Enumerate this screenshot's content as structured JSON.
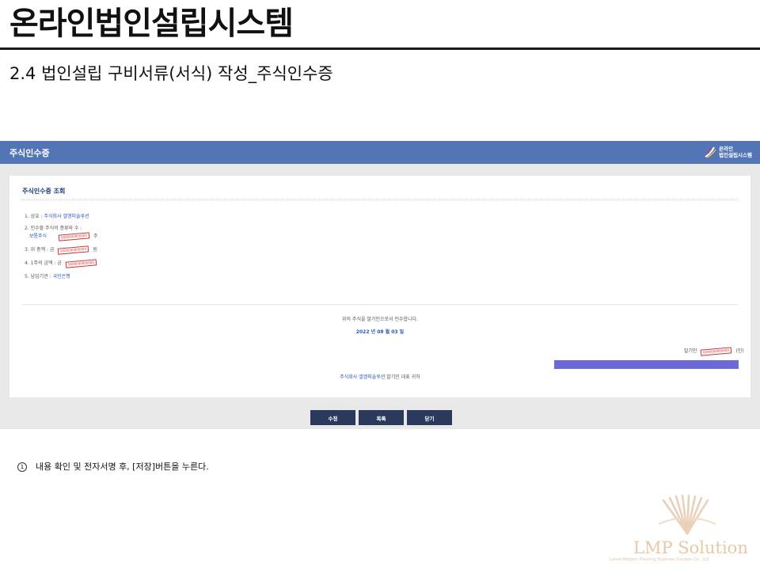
{
  "slide": {
    "title": "온라인법인설립시스템",
    "subtitle": "2.4 법인설립 구비서류(서식) 작성_주식인수증"
  },
  "app": {
    "header_title": "주식인수증",
    "logo_line1": "온라인",
    "logo_line2": "법인설립시스템"
  },
  "panel": {
    "title": "주식인수증 조회",
    "row1_label": "1. 상호 : ",
    "row1_value": "주식회사 엘엠피솔루션",
    "row2_label": "2. 인수할 주식의 종류와 수 :",
    "row2_kind": "보통주식",
    "row2_unit": "주",
    "row3_label": "3. 위 총액 : 금",
    "row3_unit": "원",
    "row4_label": "4. 1주의 금액 : 금",
    "row5_label": "5. 납입기관 : ",
    "row5_value": "국민은행",
    "stamp_text": "0000000000000",
    "statement": "위의 주식을 발기인으로서 인수합니다.",
    "date": "2022 년 08 월 03 일",
    "issuer_label": "발기인",
    "issuer_seal": "(인)",
    "company_name": "주식회사 엘엠피솔루션",
    "company_suffix": " 발기인 대표 귀하"
  },
  "buttons": {
    "edit": "수정",
    "list": "목록",
    "close": "닫기"
  },
  "note": {
    "number": "1",
    "text": "내용 확인 및 전자서명 후, [저장]버튼을 누른다."
  },
  "footer": {
    "brand": "LMP Solution",
    "tagline": "Latest Modern Planning Business Solution Co., Ltd"
  },
  "colors": {
    "header_bg": "#5374b5",
    "button_bg": "#2b3a5c",
    "sign_bar": "#6b6ad8",
    "stamp": "#d03030"
  }
}
